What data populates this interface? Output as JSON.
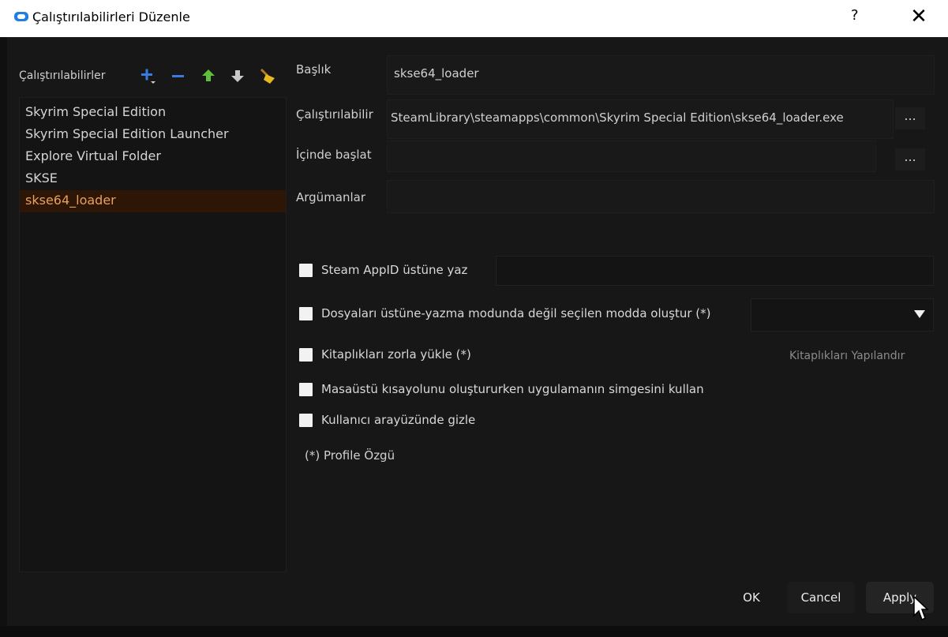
{
  "window": {
    "title": "Çalıştırılabilirleri Düzenle",
    "help": "?",
    "close": "✕"
  },
  "sidebar": {
    "header": "Çalıştırılabilirler",
    "items": [
      {
        "label": "Skyrim Special Edition"
      },
      {
        "label": "Skyrim Special Edition Launcher"
      },
      {
        "label": "Explore Virtual Folder"
      },
      {
        "label": "SKSE"
      },
      {
        "label": "skse64_loader",
        "selected": true
      }
    ]
  },
  "form": {
    "title_label": "Başlık",
    "title_value": "skse64_loader",
    "binary_label": "Çalıştırılabilir",
    "binary_value": "SteamLibrary\\steamapps\\common\\Skyrim Special Edition\\skse64_loader.exe",
    "start_in_label": "İçinde başlat",
    "start_in_value": "",
    "arguments_label": "Argümanlar",
    "arguments_value": "",
    "browse": "..."
  },
  "options": {
    "steam_appid": "Steam AppID üstüne yaz",
    "create_files": "Dosyaları üstüne-yazma modunda değil seçilen modda oluştur (*)",
    "force_libs": "Kitaplıkları zorla yükle (*)",
    "configure_libs": "Kitaplıkları Yapılandır",
    "use_icon": "Masaüstü kısayolunu oluştururken uygulamanın simgesini kullan",
    "hide_ui": "Kullanıcı arayüzünde gizle",
    "note": "(*) Profile Özgü"
  },
  "buttons": {
    "ok": "OK",
    "cancel": "Cancel",
    "apply": "Apply"
  },
  "colors": {
    "accent_selected_text": "#e8a15a",
    "selected_bg": "#2e1606",
    "add_icon": "#3a7be0",
    "move_up_icon": "#5fbf3a",
    "clean_icon": "#e8b820"
  }
}
